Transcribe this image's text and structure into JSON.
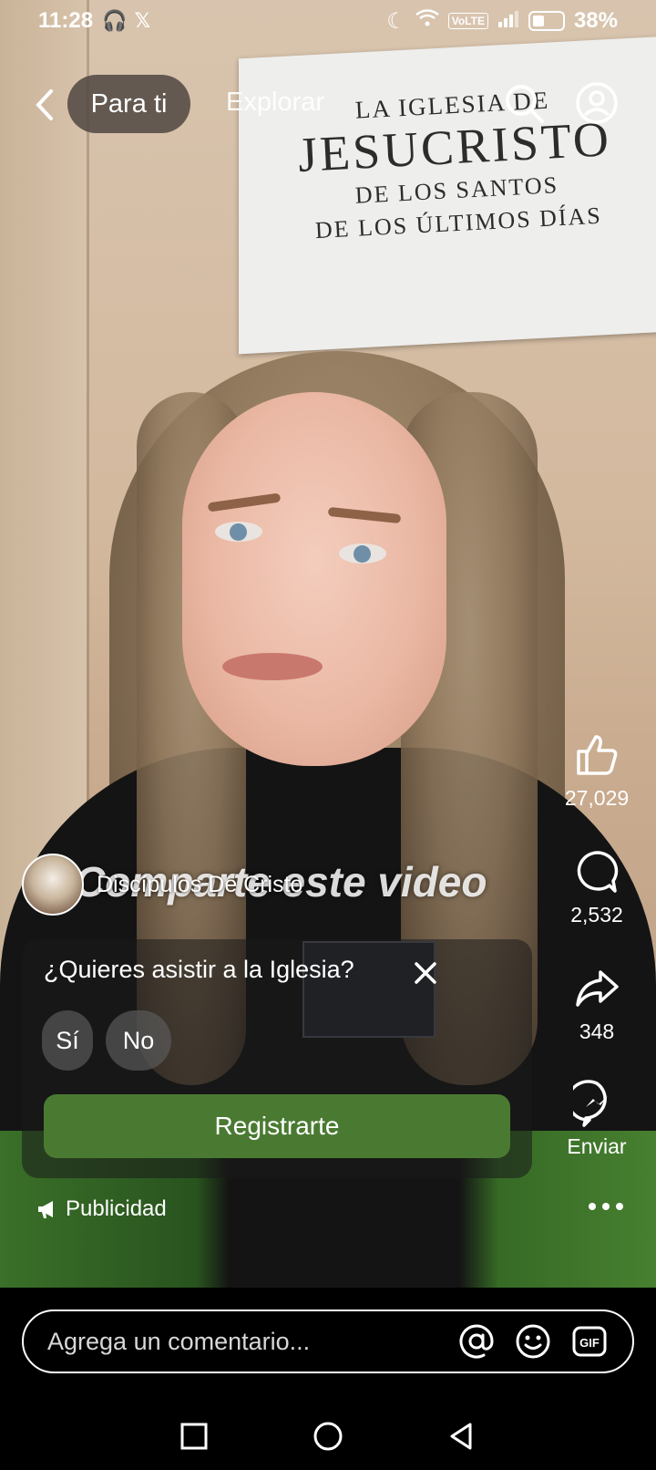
{
  "status_bar": {
    "time": "11:28",
    "battery": "38%",
    "network": "VoLTE"
  },
  "top_nav": {
    "active_tab": "Para ti",
    "other_tab": "Explorar",
    "icons": [
      "back-icon",
      "search-icon",
      "profile-icon"
    ]
  },
  "video": {
    "sign_lines": [
      "LA IGLESIA DE",
      "JESUCRISTO",
      "DE LOS SANTOS",
      "DE LOS ÚLTIMOS DÍAS"
    ],
    "overlay_text": "Comparte este video"
  },
  "side_actions": {
    "likes": "27,029",
    "comments": "2,532",
    "shares": "348",
    "send_label": "Enviar"
  },
  "author": {
    "name": "Discípulos De Cristo"
  },
  "ad": {
    "question": "¿Quieres asistir a la Iglesia?",
    "option_yes": "Sí",
    "option_no": "No",
    "cta": "Registrarte",
    "sponsored_label": "Publicidad"
  },
  "comment_bar": {
    "placeholder": "Agrega un comentario...",
    "icons": [
      "at-icon",
      "emoji-icon",
      "gif-icon"
    ]
  },
  "system_nav": {
    "icons": [
      "recents-icon",
      "home-icon",
      "back-triangle-icon"
    ]
  },
  "colors": {
    "cta_green": "#4a7a32",
    "pill_bg": "#50463f"
  }
}
